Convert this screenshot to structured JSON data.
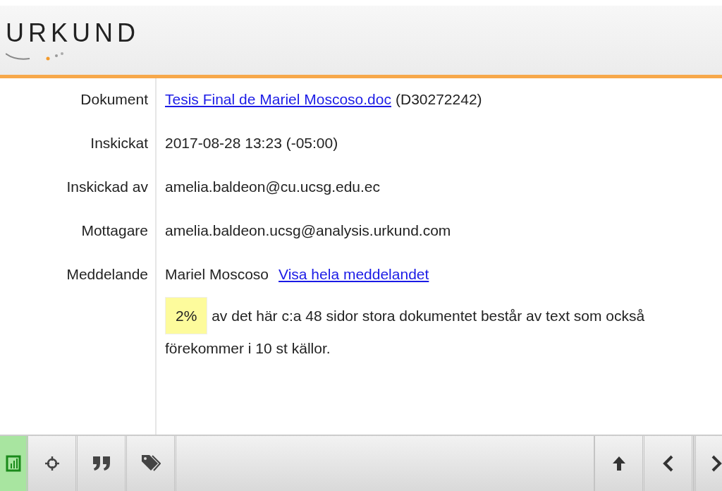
{
  "logo": {
    "text": "URKUND"
  },
  "details": [
    {
      "label": "Dokument",
      "kind": "link_suffix",
      "link": "Tesis Final de Mariel Moscoso.doc",
      "text": "(D30272242)"
    },
    {
      "label": "Inskickat",
      "kind": "plain",
      "text": "2017-08-28 13:23 (-05:00)"
    },
    {
      "label": "Inskickad av",
      "kind": "plain",
      "text": "amelia.baldeon@cu.ucsg.edu.ec"
    },
    {
      "label": "Mottagare",
      "kind": "plain",
      "text": "amelia.baldeon.ucsg@analysis.urkund.com"
    },
    {
      "label": "Meddelande",
      "kind": "text_link",
      "text": "Mariel Moscoso",
      "link": "Visa hela meddelandet"
    }
  ],
  "summary": {
    "percent": "2%",
    "text": "av det här c:a 48 sidor stora dokumentet består av text som också förekommer i 10 st källor."
  },
  "toolbar": {
    "left": [
      {
        "kind": "chart",
        "selected": true
      },
      {
        "kind": "target",
        "selected": false
      },
      {
        "kind": "quote",
        "selected": false
      },
      {
        "kind": "tag",
        "selected": false
      }
    ],
    "right": [
      {
        "kind": "up"
      },
      {
        "kind": "prev"
      },
      {
        "kind": "next"
      }
    ]
  }
}
